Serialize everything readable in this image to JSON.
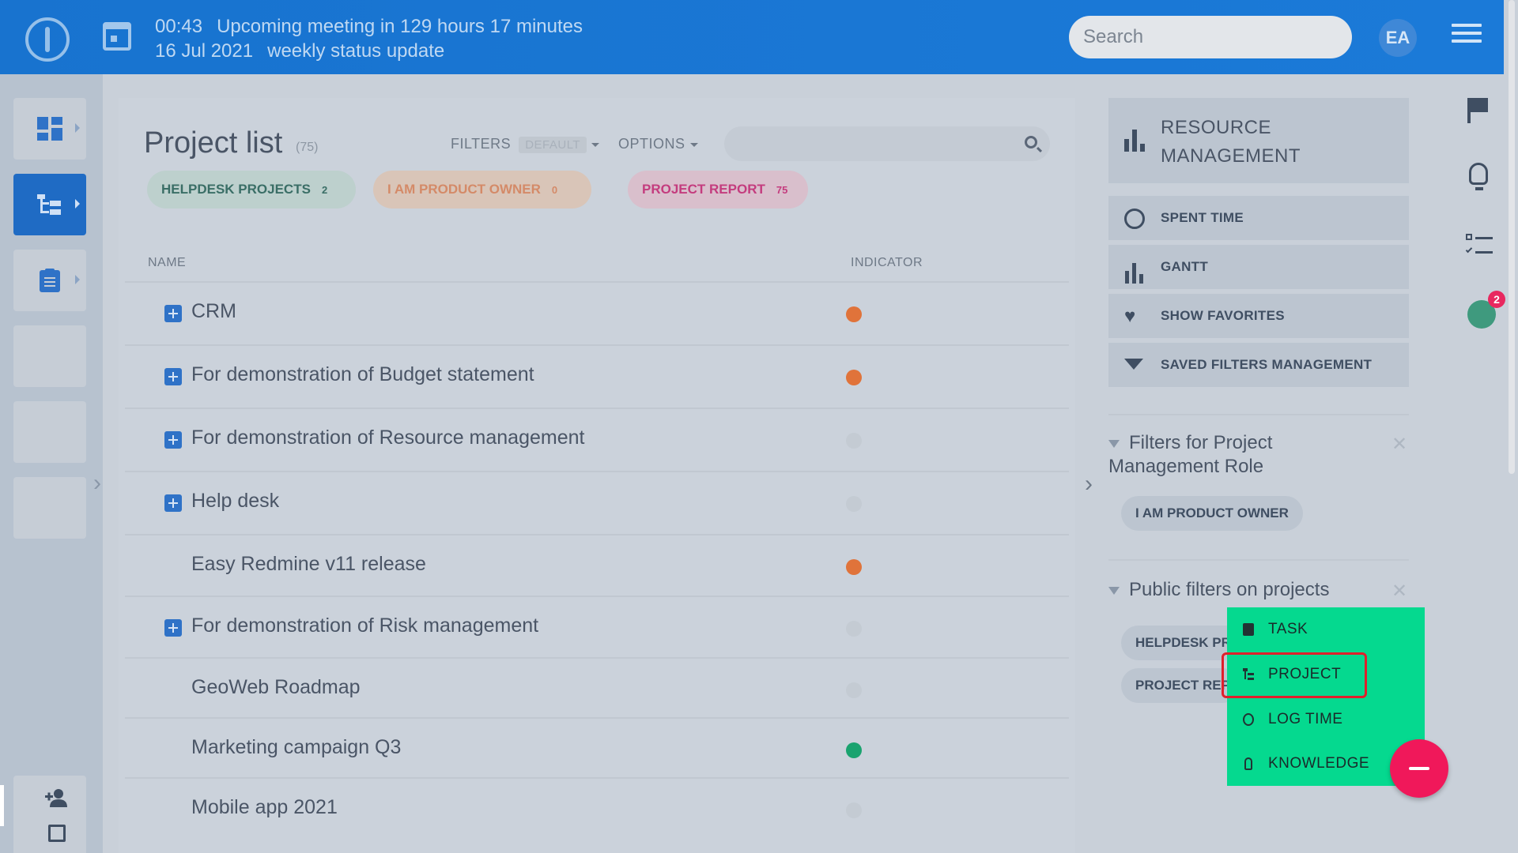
{
  "topbar": {
    "meeting_time": "00:43",
    "meeting_text": "Upcoming meeting in 129 hours 17 minutes",
    "meeting_date": "16 Jul 2021",
    "meeting_name": "weekly status update",
    "search_placeholder": "Search",
    "avatar_initials": "EA"
  },
  "main": {
    "title": "Project list",
    "count": "(75)",
    "filters_label": "FILTERS",
    "filters_value": "DEFAULT",
    "options_label": "OPTIONS",
    "tags": [
      {
        "label": "HELPDESK PROJECTS",
        "count": "2"
      },
      {
        "label": "I AM PRODUCT OWNER",
        "count": "0"
      },
      {
        "label": "PROJECT REPORT",
        "count": "75"
      }
    ],
    "columns": {
      "name": "NAME",
      "indicator": "INDICATOR"
    },
    "rows": [
      {
        "name": "CRM",
        "expandable": true,
        "indicator": "#e0733a"
      },
      {
        "name": "For demonstration of Budget statement",
        "expandable": true,
        "indicator": "#e0733a"
      },
      {
        "name": "For demonstration of Resource management",
        "expandable": true,
        "indicator": "#c4cbd3"
      },
      {
        "name": "Help desk",
        "expandable": true,
        "indicator": "#c4cbd3"
      },
      {
        "name": "Easy Redmine v11 release",
        "expandable": false,
        "indicator": "#e0733a"
      },
      {
        "name": "For demonstration of Risk management",
        "expandable": true,
        "indicator": "#c4cbd3"
      },
      {
        "name": "GeoWeb Roadmap",
        "expandable": false,
        "indicator": "#c4cbd3"
      },
      {
        "name": "Marketing campaign Q3",
        "expandable": false,
        "indicator": "#1aa36f"
      },
      {
        "name": "Mobile app 2021",
        "expandable": false,
        "indicator": "#c4cbd3"
      }
    ]
  },
  "right": {
    "header_line1": "RESOURCE",
    "header_line2": "MANAGEMENT",
    "buttons": [
      "SPENT TIME",
      "GANTT",
      "SHOW FAVORITES",
      "SAVED FILTERS MANAGEMENT"
    ],
    "filters_role_title_1": "Filters for Project",
    "filters_role_title_2": "Management Role",
    "role_chip": "I AM PRODUCT OWNER",
    "public_filters_title": "Public filters on projects",
    "public_chips": [
      "HELPDESK PROJECTS",
      "PROJECT REPORT"
    ]
  },
  "strip": {
    "timer_badge": "2"
  },
  "quick_menu": {
    "items": [
      "TASK",
      "PROJECT",
      "LOG TIME",
      "KNOWLEDGE"
    ]
  },
  "colors": {
    "topbar": "#1976d2",
    "accent_green": "#05d98f",
    "fab": "#f0185a",
    "highlight": "#e0202c"
  }
}
